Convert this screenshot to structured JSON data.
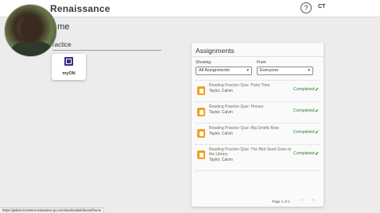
{
  "header": {
    "brand": "Renaissance",
    "help_icon_text": "?",
    "user_initials": "CT"
  },
  "page": {
    "title": "ome",
    "practice_heading": "ractice"
  },
  "practice_apps": [
    {
      "label": "myON",
      "icon": "myon-logo-icon",
      "color": "#3b2a86"
    }
  ],
  "assignments": {
    "title": "Assignments",
    "showing_label": "Showing",
    "showing_value": "All Assignments",
    "from_label": "From",
    "from_value": "Everyone",
    "items": [
      {
        "name": "Reading Practice Quiz: Party Time",
        "student": "Taylor, Calvin",
        "status": "Completed"
      },
      {
        "name": "Reading Practice Quiz: Horses",
        "student": "Taylor, Calvin",
        "status": "Completed"
      },
      {
        "name": "Reading Practice Quiz: Big Smelly Bear",
        "student": "Taylor, Calvin",
        "status": "Completed"
      },
      {
        "name": "Reading Practice Quiz: The Bird Seed Goes to the Library",
        "student": "Taylor, Calvin",
        "status": "Completed"
      }
    ],
    "pagination": "Page 1 of 1",
    "prev_icon": "chevron-left-icon",
    "next_icon": "chevron-right-icon"
  },
  "browser_status_url": "https://global-zone65.renaissance-go.com/studentdashboard/home",
  "colors": {
    "completed": "#2e7d32",
    "quiz_icon": "#f0a020",
    "myon_brand": "#3b2a86"
  }
}
